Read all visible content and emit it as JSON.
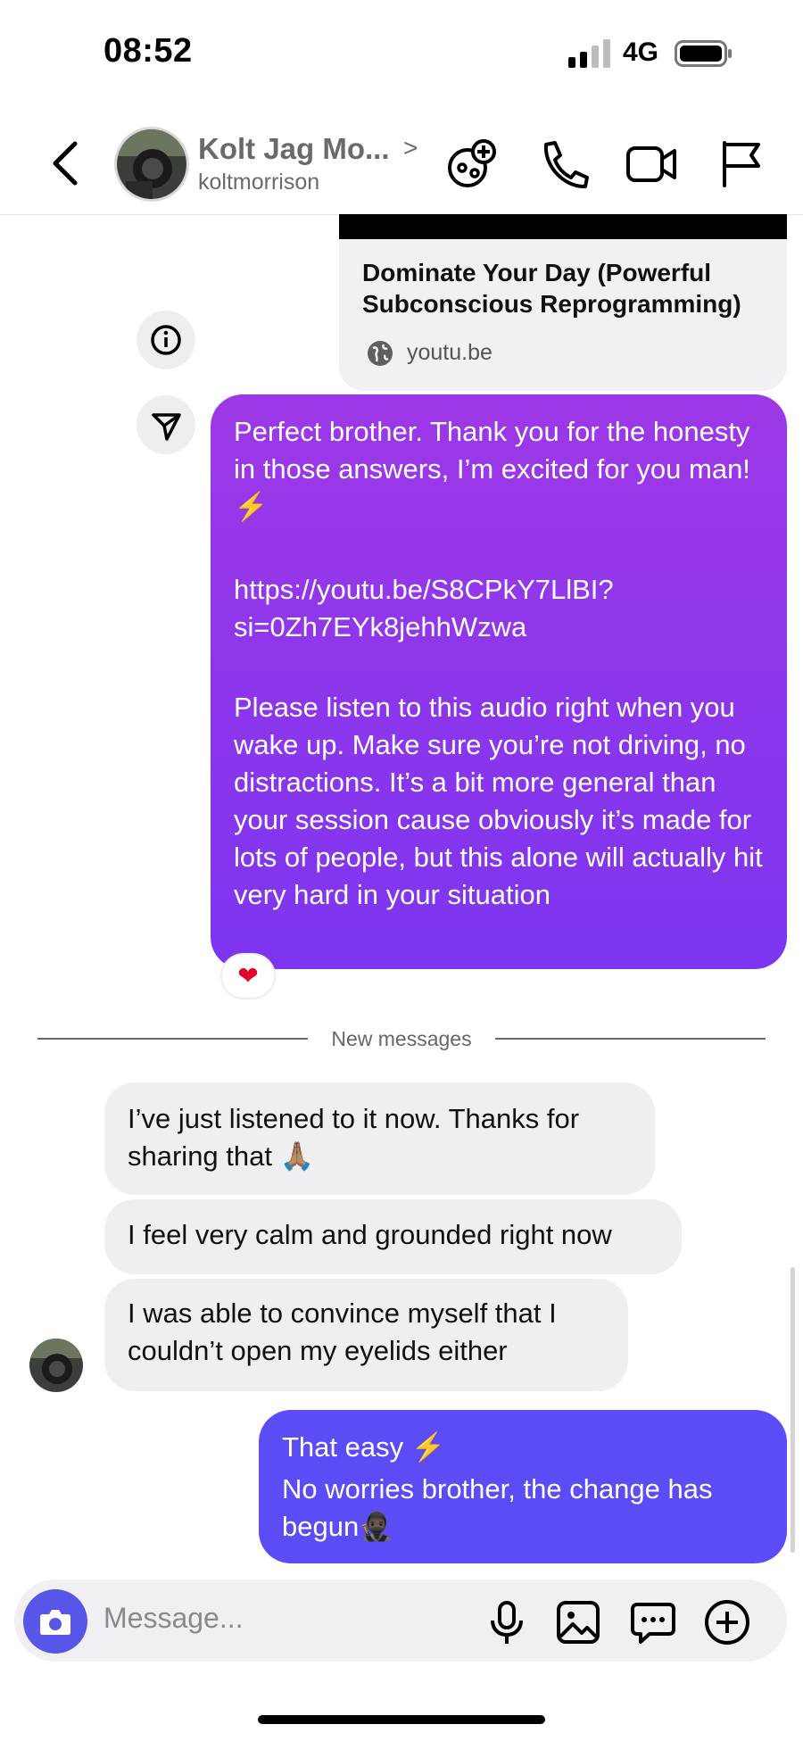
{
  "status_bar": {
    "time": "08:52",
    "network": "4G"
  },
  "header": {
    "name": "Kolt Jag Mo...",
    "chevron": ">",
    "username": "koltmorrison",
    "icons": [
      "back-icon",
      "add-effect-icon",
      "phone-icon",
      "video-icon",
      "flag-icon"
    ]
  },
  "link_preview": {
    "title": "Dominate Your Day (Powerful Subconscious Reprogramming)",
    "domain": "youtu.be"
  },
  "messages": {
    "sent_1": {
      "para1": "Perfect brother. Thank you for the honesty in those answers, I’m excited for you man!⚡",
      "para2": "https://youtu.be/S8CPkY7LlBI?si=0Zh7EYk8jehhWzwa",
      "para3": "Please listen to this audio right when you wake up. Make sure you’re not driving, no distractions. It’s a bit more general than your session cause obviously it’s made for lots of people, but this alone will actually hit very hard in your situation",
      "reaction": "❤"
    },
    "divider": "New messages",
    "received": [
      "I’ve just listened to it now. Thanks for sharing that 🙏🏽",
      "I feel very calm and grounded right now",
      "I was able to convince myself that I couldn’t open my eyelids either"
    ],
    "sent_2": {
      "line1": "That easy ⚡",
      "line2": "No worries brother, the change has begun🥷🏿"
    }
  },
  "composer": {
    "placeholder": "Message...",
    "icons": [
      "camera-icon",
      "microphone-icon",
      "gallery-icon",
      "sticker-icon",
      "plus-icon"
    ]
  },
  "colors": {
    "purple_bubble_top": "#9d38e6",
    "purple_bubble_bottom": "#7d35f0",
    "blue_bubble": "#5b4cf5",
    "camera_button": "#5856e8"
  }
}
